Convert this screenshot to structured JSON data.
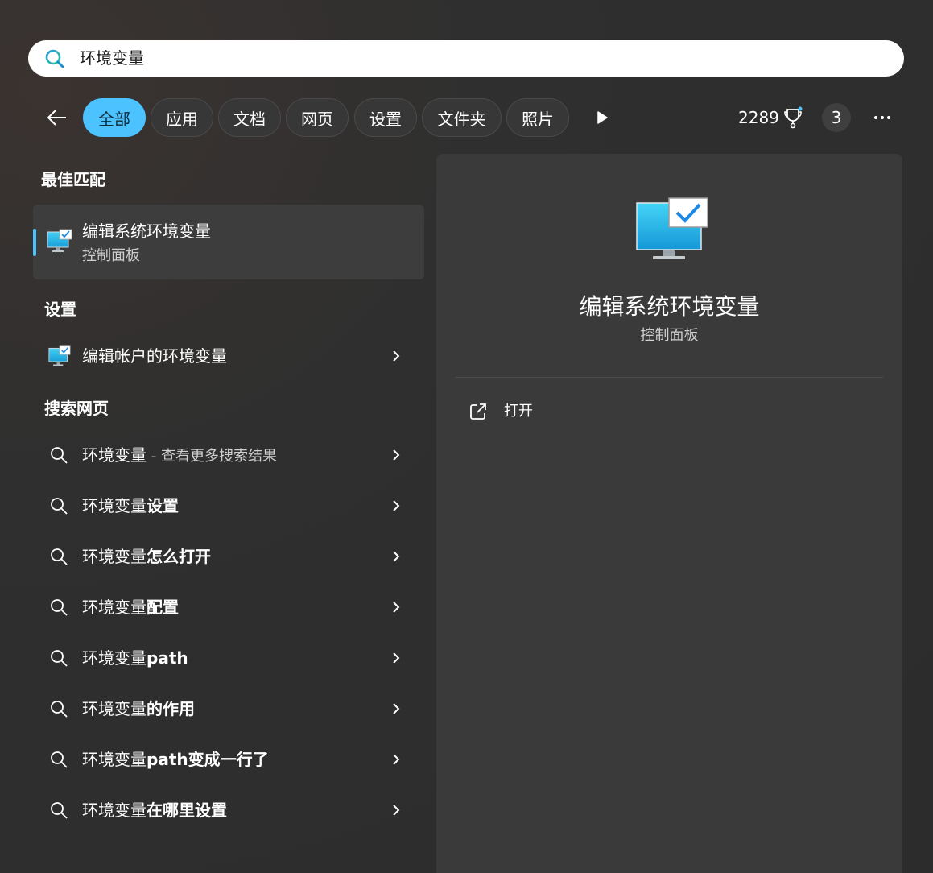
{
  "search": {
    "query": "环境变量"
  },
  "filters": {
    "chips": [
      {
        "label": "全部",
        "active": true
      },
      {
        "label": "应用"
      },
      {
        "label": "文档"
      },
      {
        "label": "网页"
      },
      {
        "label": "设置"
      },
      {
        "label": "文件夹"
      },
      {
        "label": "照片"
      }
    ],
    "points": "2289",
    "notification_count": "3"
  },
  "best_match": {
    "section_title": "最佳匹配",
    "title": "编辑系统环境变量",
    "subtitle": "控制面板"
  },
  "settings": {
    "section_title": "设置",
    "items": [
      {
        "label": "编辑帐户的环境变量"
      }
    ]
  },
  "web": {
    "section_title": "搜索网页",
    "first": {
      "query": "环境变量",
      "suffix": " - 查看更多搜索结果"
    },
    "items": [
      {
        "prefix": "环境变量",
        "bold": "设置"
      },
      {
        "prefix": "环境变量",
        "bold": "怎么打开"
      },
      {
        "prefix": "环境变量",
        "bold": "配置"
      },
      {
        "prefix": "环境变量",
        "bold": "path"
      },
      {
        "prefix": "环境变量",
        "bold": "的作用"
      },
      {
        "prefix": "环境变量",
        "bold": "path变成一行了"
      },
      {
        "prefix": "环境变量",
        "bold": "在哪里设置"
      }
    ]
  },
  "detail": {
    "title": "编辑系统环境变量",
    "subtitle": "控制面板",
    "actions": [
      {
        "label": "打开"
      }
    ]
  },
  "colors": {
    "accent": "#4cc2ff",
    "background": "#2c2c2c",
    "panel": "#3a3a3a"
  }
}
